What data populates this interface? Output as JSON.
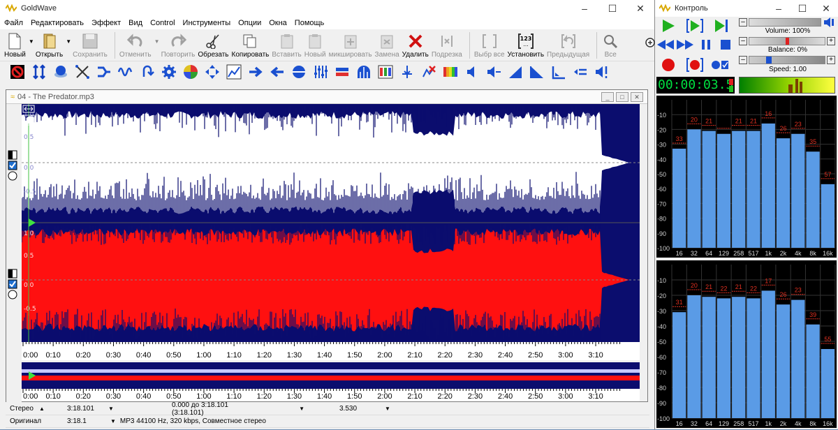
{
  "main_window": {
    "title": "GoldWave",
    "window_controls": [
      "–",
      "☐",
      "✕"
    ]
  },
  "menu": [
    "Файл",
    "Редактировать",
    "Эффект",
    "Вид",
    "Control",
    "Инструменты",
    "Опции",
    "Окна",
    "Помощь"
  ],
  "toolbar": [
    {
      "label": "Новый",
      "icon": "new-file-icon",
      "enabled": true
    },
    {
      "label": "Открыть",
      "icon": "open-folder-icon",
      "enabled": true
    },
    {
      "label": "Сохранить",
      "icon": "save-disk-icon",
      "enabled": false
    },
    {
      "label": "Отменить",
      "icon": "undo-icon",
      "enabled": false
    },
    {
      "label": "Повторить",
      "icon": "redo-icon",
      "enabled": false
    },
    {
      "label": "Обрезать",
      "icon": "scissors-icon",
      "enabled": true
    },
    {
      "label": "Копировать",
      "icon": "copy-icon",
      "enabled": true
    },
    {
      "label": "Вставить",
      "icon": "paste-icon",
      "enabled": false
    },
    {
      "label": "Новый",
      "icon": "paste-new-icon",
      "enabled": false
    },
    {
      "label": "микшировать",
      "icon": "mix-icon",
      "enabled": false
    },
    {
      "label": "Замена",
      "icon": "replace-icon",
      "enabled": false
    },
    {
      "label": "Удалить",
      "icon": "delete-x-icon",
      "enabled": true
    },
    {
      "label": "Подрезка",
      "icon": "trim-icon",
      "enabled": false
    },
    {
      "label": "Выбр все",
      "icon": "select-all-icon",
      "enabled": false
    },
    {
      "label": "Установить",
      "icon": "set-marker-icon",
      "enabled": true
    },
    {
      "label": "Предыдущая",
      "icon": "previous-icon",
      "enabled": false
    },
    {
      "label": "Все",
      "icon": "zoom-all-icon",
      "enabled": false
    }
  ],
  "document": {
    "title": "04 - The Predator.mp3",
    "doc_controls": [
      "_",
      "□",
      "✕"
    ],
    "top_channel_ticks": [
      "1.0",
      "0.5",
      "0.0",
      "-0.5"
    ],
    "bottom_channel_ticks": [
      "1.0",
      "0.5",
      "0.0",
      "-0.5"
    ],
    "time_ticks": [
      "0:00",
      "0:10",
      "0:20",
      "0:30",
      "0:40",
      "0:50",
      "1:00",
      "1:10",
      "1:20",
      "1:30",
      "1:40",
      "1:50",
      "2:00",
      "2:10",
      "2:20",
      "2:30",
      "2:40",
      "2:50",
      "3:00",
      "3:10"
    ]
  },
  "status": {
    "row1": {
      "mode": "Стерео",
      "length": "3:18.101",
      "selection": "0.000 до 3:18.101 (3:18.101)",
      "position": "3.530"
    },
    "row2": {
      "label": "Оригинал",
      "length": "3:18.1",
      "format": "MP3 44100 Hz, 320 kbps, Совместное стерео"
    }
  },
  "control_window": {
    "title": "Контроль",
    "volume_label": "Volume: 100%",
    "balance_label": "Balance: 0%",
    "speed_label": "Speed: 1.00",
    "time": "00:00:03.5",
    "volume_fraction": 1.0,
    "balance_fraction": 0.5,
    "speed_fraction": 0.33
  },
  "chart_data": [
    {
      "type": "bar",
      "title": "",
      "categories": [
        "16",
        "32",
        "64",
        "129",
        "258",
        "517",
        "1k",
        "2k",
        "4k",
        "8k",
        "16k"
      ],
      "values": [
        -33,
        -20,
        -21,
        -23,
        -21,
        -21,
        -16,
        -26,
        -23,
        -35,
        -57
      ],
      "bar_labels": [
        "33",
        "20",
        "21",
        "",
        "21",
        "21",
        "16",
        "26",
        "23",
        "35",
        "57"
      ],
      "y_ticks": [
        "-10",
        "-20",
        "-30",
        "-40",
        "-50",
        "-60",
        "-70",
        "-80",
        "-90",
        "-100"
      ],
      "ylim": [
        -100,
        0
      ]
    },
    {
      "type": "bar",
      "title": "",
      "categories": [
        "16",
        "32",
        "64",
        "129",
        "258",
        "517",
        "1k",
        "2k",
        "4k",
        "8k",
        "16k"
      ],
      "values": [
        -31,
        -20,
        -21,
        -22,
        -21,
        -22,
        -17,
        -26,
        -23,
        -39,
        -55
      ],
      "bar_labels": [
        "31",
        "20",
        "21",
        "22",
        "21",
        "22",
        "17",
        "26",
        "23",
        "39",
        "55"
      ],
      "y_ticks": [
        "-10",
        "-20",
        "-30",
        "-40",
        "-50",
        "-60",
        "-70",
        "-80",
        "-90",
        "-100"
      ],
      "ylim": [
        -100,
        0
      ]
    }
  ],
  "colors": {
    "wave_bg": "#0b0d6e",
    "top_channel": "#ffffff",
    "bottom_channel": "#ff1010",
    "spectrum_bar": "#5a9be6",
    "spectrum_peak": "#e03020",
    "time_display": "#00e040"
  }
}
